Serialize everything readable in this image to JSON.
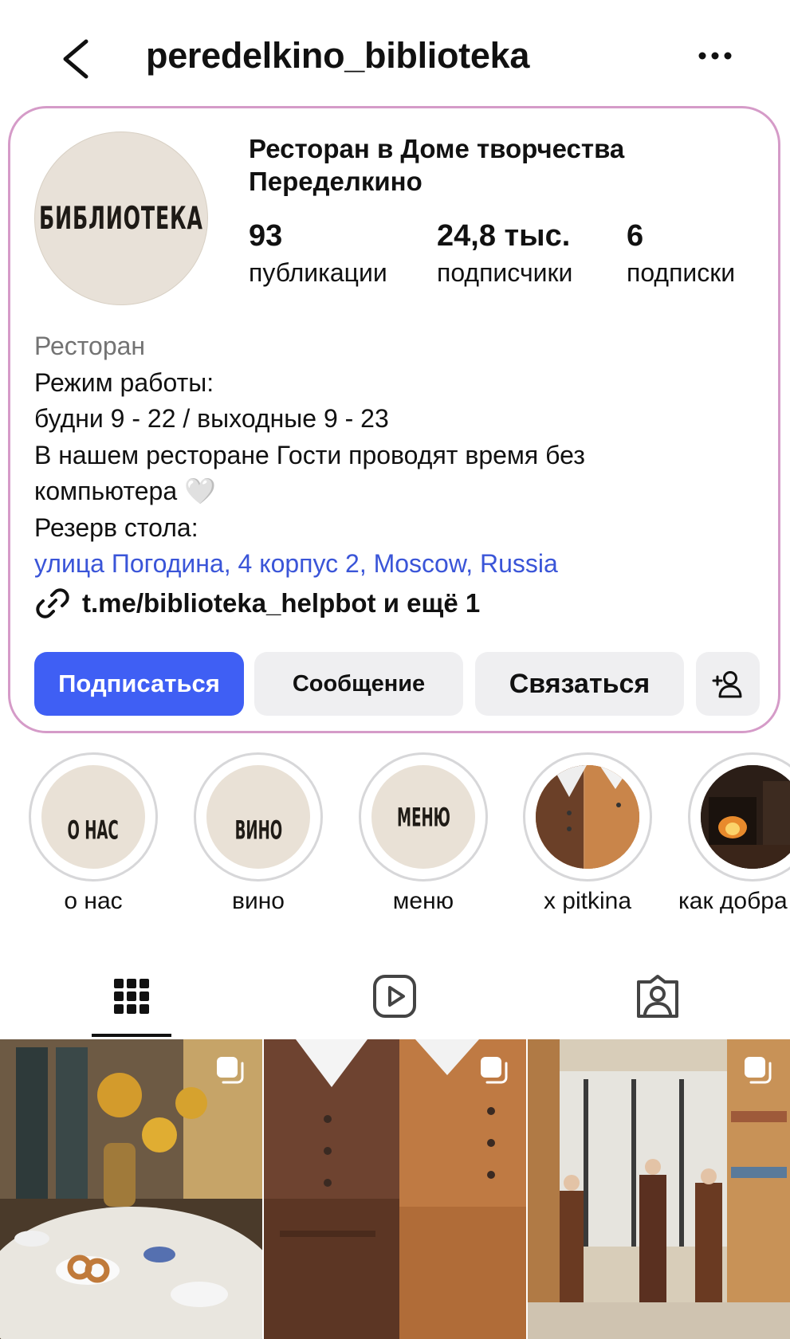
{
  "header": {
    "username": "peredelkino_biblioteka",
    "back_icon": "chevron-left-icon",
    "more_icon": "more-horizontal-icon"
  },
  "profile": {
    "avatar_text": "БИБЛИОТЕКА",
    "display_name": "Ресторан в Доме творчества Переделкино",
    "stats": [
      {
        "value": "93",
        "label": "публикации"
      },
      {
        "value": "24,8 тыс.",
        "label": "подписчики"
      },
      {
        "value": "6",
        "label": "подписки"
      }
    ],
    "category": "Ресторан",
    "bio_lines": [
      "Режим работы:",
      "будни 9 - 22 / выходные 9 - 23",
      "В нашем ресторане Гости проводят время без",
      "компьютера 🤍",
      "Резерв стола:"
    ],
    "address": "улица Погодина, 4 корпус 2, Moscow, Russia",
    "link": "t.me/biblioteka_helpbot и ещё 1",
    "link_icon": "link-icon"
  },
  "actions": {
    "follow": "Подписаться",
    "message": "Сообщение",
    "contact": "Связаться",
    "add_person_icon": "add-person-icon"
  },
  "highlights": [
    {
      "cover_text": "О НАС",
      "label": "о нас"
    },
    {
      "cover_text": "ВИНО",
      "label": "вино"
    },
    {
      "cover_text": "МЕНЮ",
      "label": "меню"
    },
    {
      "cover_text": "",
      "label": "x pitkina"
    },
    {
      "cover_text": "",
      "label": "как добра"
    }
  ],
  "tabs": [
    {
      "icon": "grid-icon",
      "active": true
    },
    {
      "icon": "reels-icon",
      "active": false
    },
    {
      "icon": "tagged-icon",
      "active": false
    }
  ],
  "colors": {
    "accent": "#3f5ff4",
    "address_link": "#3a55d8",
    "card_border": "#d59bc8",
    "secondary_button": "#efeff1",
    "avatar_bg": "#e8e1d8"
  }
}
